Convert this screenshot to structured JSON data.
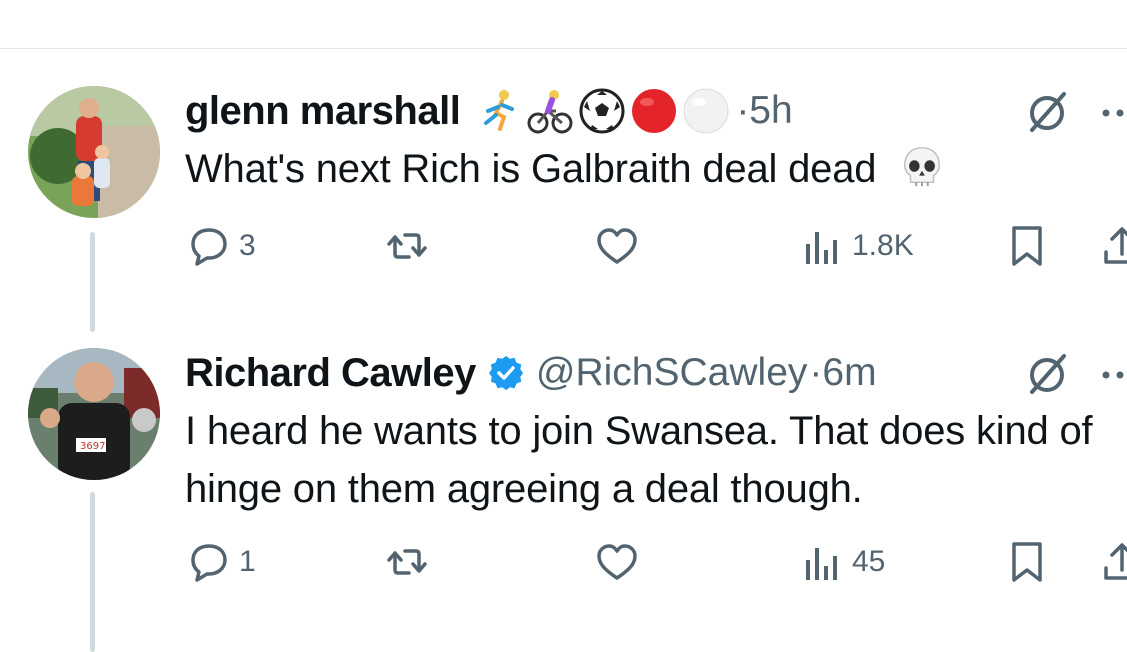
{
  "tweets": [
    {
      "display_name": "glenn marshall",
      "emojis": [
        "runner-emoji",
        "cyclist-emoji",
        "soccer-ball-emoji",
        "red-circle-emoji",
        "white-circle-emoji"
      ],
      "handle": "",
      "time": "·5h",
      "text": "What's next Rich is Galbraith deal dead",
      "text_emoji": "skull-emoji",
      "replies": "3",
      "retweets": "",
      "likes": "",
      "views": "1.8K",
      "verified": false
    },
    {
      "display_name": "Richard Cawley",
      "emojis": [],
      "handle": "@RichSCawley",
      "time": "·6m",
      "text": "I heard he wants to join Swansea. That does kind of hinge on them agreeing a deal though.",
      "replies": "1",
      "retweets": "",
      "likes": "",
      "views": "45",
      "verified": true
    }
  ],
  "colors": {
    "text": "#0f1419",
    "secondary": "#536471",
    "verified": "#1d9bf0",
    "thread_line": "#cfd9de",
    "divider": "#dfe6ea"
  }
}
